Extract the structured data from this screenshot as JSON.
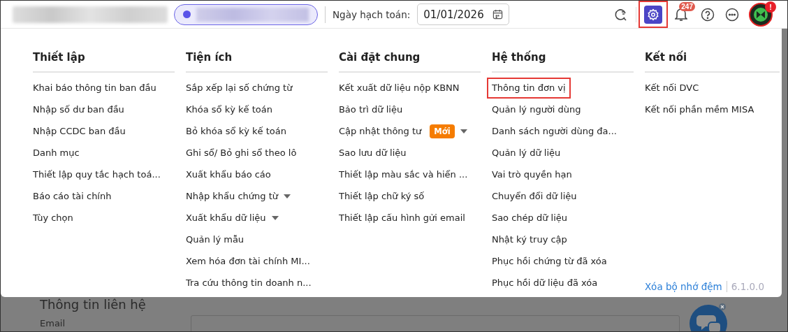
{
  "top_bar": {
    "accounting_date": {
      "label": "Ngày hạch toán:",
      "value": "01/01/2026"
    },
    "toolbar": [
      {
        "kind": "refresh-search",
        "highlighted": false
      },
      {
        "kind": "settings",
        "highlighted": true
      },
      {
        "kind": "bell",
        "badge": "247",
        "highlighted": false
      },
      {
        "kind": "help",
        "highlighted": false
      },
      {
        "kind": "more",
        "highlighted": false
      },
      {
        "kind": "avatar",
        "badge": "!",
        "highlighted": false
      }
    ]
  },
  "settings_menu": {
    "columns": [
      {
        "title": "Thiết lập",
        "items": [
          {
            "label": "Khai báo thông tin ban đầu",
            "has_submenu": false,
            "highlighted": false
          },
          {
            "label": "Nhập số dư ban đầu",
            "has_submenu": false,
            "highlighted": false
          },
          {
            "label": "Nhập CCDC ban đầu",
            "has_submenu": false,
            "highlighted": false
          },
          {
            "label": "Danh mục",
            "has_submenu": false,
            "highlighted": false
          },
          {
            "label": "Thiết lập quy tắc hạch toá...",
            "has_submenu": false,
            "highlighted": false
          },
          {
            "label": "Báo cáo tài chính",
            "has_submenu": false,
            "highlighted": false
          },
          {
            "label": "Tùy chọn",
            "has_submenu": false,
            "highlighted": false
          }
        ]
      },
      {
        "title": "Tiện ích",
        "items": [
          {
            "label": "Sắp xếp lại số chứng từ",
            "has_submenu": false,
            "highlighted": false
          },
          {
            "label": "Khóa sổ kỳ kế toán",
            "has_submenu": false,
            "highlighted": false
          },
          {
            "label": "Bỏ khóa sổ kỳ kế toán",
            "has_submenu": false,
            "highlighted": false
          },
          {
            "label": "Ghi sổ/ Bỏ ghi sổ theo lô",
            "has_submenu": false,
            "highlighted": false
          },
          {
            "label": "Xuất khẩu báo cáo",
            "has_submenu": false,
            "highlighted": false
          },
          {
            "label": "Nhập khẩu chứng từ",
            "has_submenu": true,
            "highlighted": false
          },
          {
            "label": "Xuất khẩu dữ liệu",
            "has_submenu": true,
            "highlighted": false
          },
          {
            "label": "Quản lý mẫu",
            "has_submenu": false,
            "highlighted": false
          },
          {
            "label": "Xem hóa đơn tài chính MI...",
            "has_submenu": false,
            "highlighted": false
          },
          {
            "label": "Tra cứu thông tin doanh n...",
            "has_submenu": false,
            "highlighted": false
          }
        ]
      },
      {
        "title": "Cài đặt chung",
        "items": [
          {
            "label": "Kết xuất dữ liệu nộp KBNN",
            "has_submenu": false,
            "highlighted": false
          },
          {
            "label": "Bảo trì dữ liệu",
            "has_submenu": false,
            "highlighted": false
          },
          {
            "label": "Cập nhật thông tư",
            "badge": "Mới",
            "has_submenu": true,
            "highlighted": false
          },
          {
            "label": "Sao lưu dữ liệu",
            "has_submenu": false,
            "highlighted": false
          },
          {
            "label": "Thiết lập màu sắc và hiển ...",
            "has_submenu": false,
            "highlighted": false
          },
          {
            "label": "Thiết lập chữ ký số",
            "has_submenu": false,
            "highlighted": false
          },
          {
            "label": "Thiết lập cấu hình gửi email",
            "has_submenu": false,
            "highlighted": false
          }
        ]
      },
      {
        "title": "Hệ thống",
        "items": [
          {
            "label": "Thông tin đơn vị",
            "has_submenu": false,
            "highlighted": true
          },
          {
            "label": "Quản lý người dùng",
            "has_submenu": false,
            "highlighted": false
          },
          {
            "label": "Danh sách người dùng đa...",
            "has_submenu": false,
            "highlighted": false
          },
          {
            "label": "Quản lý dữ liệu",
            "has_submenu": false,
            "highlighted": false
          },
          {
            "label": "Vai trò quyền hạn",
            "has_submenu": false,
            "highlighted": false
          },
          {
            "label": "Chuyển đổi dữ liệu",
            "has_submenu": false,
            "highlighted": false
          },
          {
            "label": "Sao chép dữ liệu",
            "has_submenu": false,
            "highlighted": false
          },
          {
            "label": "Nhật ký truy cập",
            "has_submenu": false,
            "highlighted": false
          },
          {
            "label": "Phục hồi chứng từ đã xóa",
            "has_submenu": false,
            "highlighted": false
          },
          {
            "label": "Phục hồi dữ liệu đã xóa",
            "has_submenu": false,
            "highlighted": false
          }
        ]
      },
      {
        "title": "Kết nối",
        "items": [
          {
            "label": "Kết nối DVC",
            "has_submenu": false,
            "highlighted": false
          },
          {
            "label": "Kết nối phần mềm MISA",
            "has_submenu": false,
            "highlighted": false
          }
        ]
      }
    ],
    "footer": {
      "clear_cache_link": "Xóa bộ nhớ đệm",
      "version": "6.1.0.0"
    }
  },
  "background_page": {
    "section_title": "Thông tin liên hệ",
    "field_label": "Email"
  }
}
